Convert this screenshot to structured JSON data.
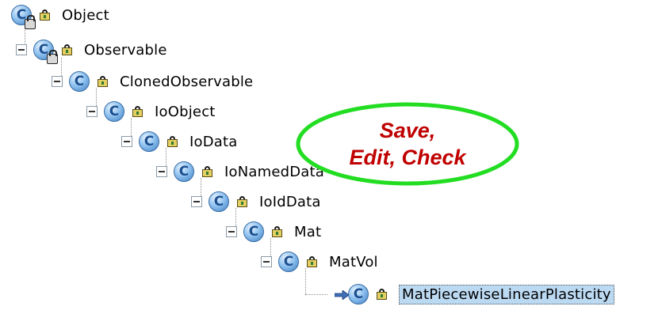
{
  "tree": {
    "nodes": [
      {
        "label": "Object",
        "expanded": null,
        "icon": "class-lock-icon",
        "selected": false
      },
      {
        "label": "Observable",
        "expanded": true,
        "icon": "class-lock-icon",
        "selected": false
      },
      {
        "label": "ClonedObservable",
        "expanded": true,
        "icon": "class-icon",
        "selected": false
      },
      {
        "label": "IoObject",
        "expanded": true,
        "icon": "class-icon",
        "selected": false
      },
      {
        "label": "IoData",
        "expanded": true,
        "icon": "class-icon",
        "selected": false
      },
      {
        "label": "IoNamedData",
        "expanded": true,
        "icon": "class-icon",
        "selected": false
      },
      {
        "label": "IoIdData",
        "expanded": true,
        "icon": "class-icon",
        "selected": false
      },
      {
        "label": "Mat",
        "expanded": true,
        "icon": "class-icon",
        "selected": false
      },
      {
        "label": "MatVol",
        "expanded": true,
        "icon": "class-icon",
        "selected": false
      },
      {
        "label": "MatPiecewiseLinearPlasticity",
        "expanded": null,
        "icon": "class-arrow-icon",
        "selected": true
      }
    ],
    "class_letter": "C"
  },
  "callout": {
    "line1": "Save,",
    "line2": "Edit, Check",
    "ellipse_color": "#22dd22",
    "text_color": "#c00000"
  }
}
